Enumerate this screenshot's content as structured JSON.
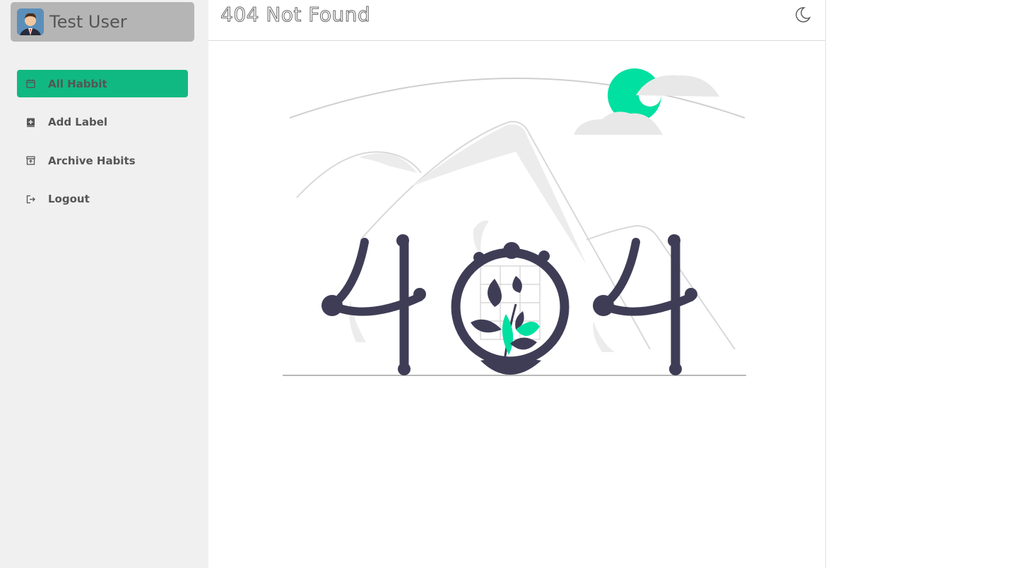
{
  "user": {
    "name": "Test User",
    "avatar_icon": "user-avatar"
  },
  "nav": {
    "items": [
      {
        "label": "All Habbit",
        "icon": "calendar-icon",
        "active": true
      },
      {
        "label": "Add Label",
        "icon": "add-box-icon",
        "active": false
      },
      {
        "label": "Archive Habits",
        "icon": "archive-icon",
        "active": false
      },
      {
        "label": "Logout",
        "icon": "logout-icon",
        "active": false
      }
    ]
  },
  "header": {
    "title": "404 Not Found",
    "theme_icon": "moon-icon"
  },
  "colors": {
    "accent": "#10b981",
    "illustration_dark": "#3f3d56",
    "illustration_green": "#00e0a0"
  }
}
